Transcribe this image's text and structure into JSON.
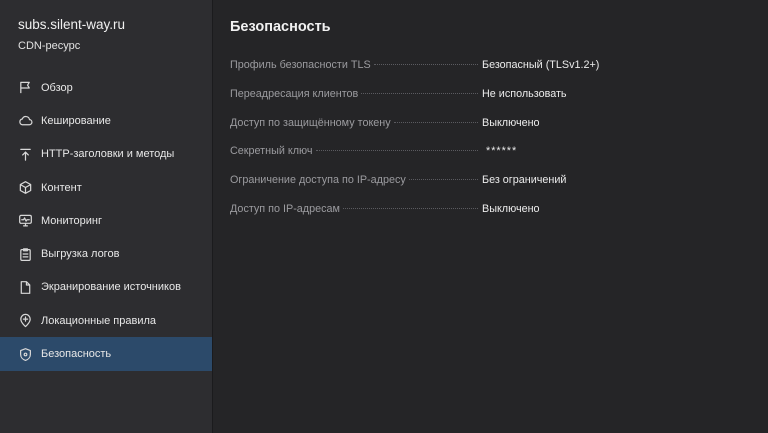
{
  "resource": {
    "domain": "subs.silent-way.ru",
    "type_label": "CDN-ресурс"
  },
  "sidebar": {
    "items": [
      {
        "label": "Обзор",
        "icon": "flag-icon",
        "active": false
      },
      {
        "label": "Кеширование",
        "icon": "cloud-icon",
        "active": false
      },
      {
        "label": "HTTP-заголовки и методы",
        "icon": "arrow-up-bar-icon",
        "active": false
      },
      {
        "label": "Контент",
        "icon": "cube-icon",
        "active": false
      },
      {
        "label": "Мониторинг",
        "icon": "monitor-icon",
        "active": false
      },
      {
        "label": "Выгрузка логов",
        "icon": "clipboard-icon",
        "active": false
      },
      {
        "label": "Экранирование источников",
        "icon": "document-icon",
        "active": false
      },
      {
        "label": "Локационные правила",
        "icon": "location-plus-icon",
        "active": false
      },
      {
        "label": "Безопасность",
        "icon": "shield-icon",
        "active": true
      }
    ]
  },
  "main": {
    "title": "Безопасность",
    "properties": [
      {
        "key": "Профиль безопасности TLS",
        "value": "Безопасный (TLSv1.2+)"
      },
      {
        "key": "Переадресация клиентов",
        "value": "Не использовать"
      },
      {
        "key": "Доступ по защищённому токену",
        "value": "Выключено"
      },
      {
        "key": "Секретный ключ",
        "value": "******",
        "secret": true
      },
      {
        "key": "Ограничение доступа по IP-адресу",
        "value": "Без ограничений"
      },
      {
        "key": "Доступ по IP-адресам",
        "value": "Выключено"
      }
    ]
  },
  "colors": {
    "background": "#252527",
    "sidebar": "#2d2d30",
    "active_item": "#2c4a6a",
    "key_text": "#9b9b9f",
    "value_text": "#ececec"
  }
}
